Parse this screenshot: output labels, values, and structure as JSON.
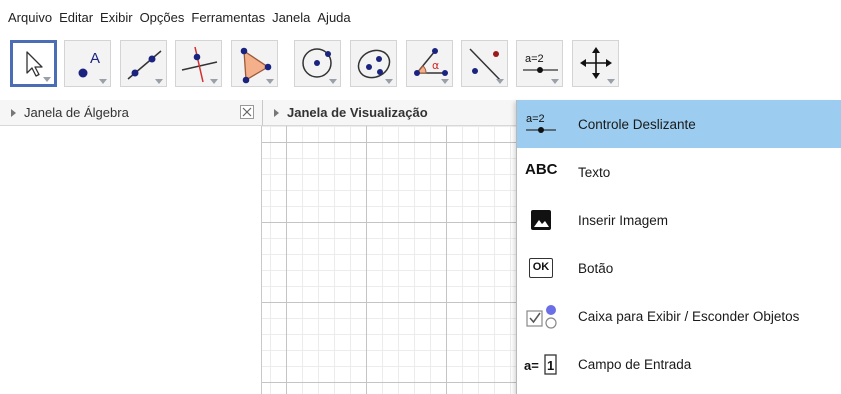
{
  "menubar": {
    "items": [
      "Arquivo",
      "Editar",
      "Exibir",
      "Opções",
      "Ferramentas",
      "Janela",
      "Ajuda"
    ]
  },
  "toolbar": {
    "tools": [
      {
        "name": "move-tool",
        "icon": "arrow-cursor-icon",
        "selected": true
      },
      {
        "name": "point-tool",
        "icon": "point-icon",
        "label": "A"
      },
      {
        "name": "line-tool",
        "icon": "line-icon"
      },
      {
        "name": "perpendicular-line-tool",
        "icon": "perpendicular-line-icon"
      },
      {
        "name": "polygon-tool",
        "icon": "polygon-icon"
      },
      {
        "name": "circle-tool",
        "icon": "circle-center-point-icon"
      },
      {
        "name": "conic-tool",
        "icon": "conic-icon"
      },
      {
        "name": "angle-tool",
        "icon": "angle-icon",
        "label": "α"
      },
      {
        "name": "reflect-tool",
        "icon": "reflect-icon"
      },
      {
        "name": "slider-tool",
        "icon": "slider-icon",
        "label": "a=2"
      },
      {
        "name": "move-graphics-tool",
        "icon": "move-graphics-icon"
      }
    ],
    "accent": "#4a6db5",
    "point_color": "#1a237e",
    "alpha_color": "#d32f2f"
  },
  "algebra": {
    "title": "Janela de Álgebra"
  },
  "graphics": {
    "title": "Janela de Visualização"
  },
  "dropdown": {
    "highlight_color": "#9ccdf0",
    "items": [
      {
        "label": "Controle Deslizante",
        "icon": "slider-icon",
        "icon_text": "a=2",
        "highlighted": true
      },
      {
        "label": "Texto",
        "icon": "text-icon",
        "icon_text": "ABC"
      },
      {
        "label": "Inserir Imagem",
        "icon": "image-icon"
      },
      {
        "label": "Botão",
        "icon": "button-icon",
        "icon_text": "OK"
      },
      {
        "label": "Caixa para Exibir / Esconder Objetos",
        "icon": "checkbox-icon"
      },
      {
        "label": "Campo de Entrada",
        "icon": "input-field-icon",
        "icon_text": "a=1"
      }
    ]
  }
}
